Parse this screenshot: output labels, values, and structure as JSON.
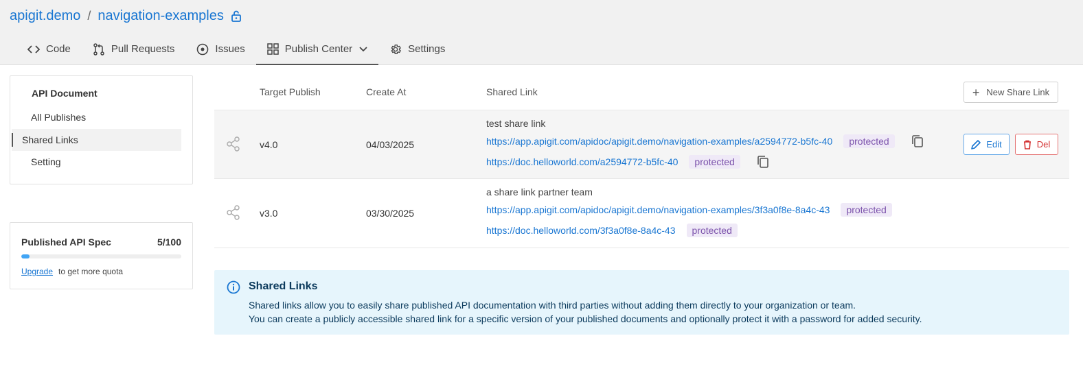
{
  "breadcrumb": {
    "org": "apigit.demo",
    "separator": "/",
    "repo": "navigation-examples"
  },
  "tabs": [
    {
      "label": "Code",
      "icon": "code-icon"
    },
    {
      "label": "Pull Requests",
      "icon": "pull-request-icon"
    },
    {
      "label": "Issues",
      "icon": "issues-icon"
    },
    {
      "label": "Publish Center",
      "icon": "grid-icon",
      "active": true
    },
    {
      "label": "Settings",
      "icon": "gear-icon"
    }
  ],
  "sidebar": {
    "title": "API Document",
    "items": [
      {
        "label": "All Publishes"
      },
      {
        "label": "Shared Links",
        "active": true
      },
      {
        "label": "Setting"
      }
    ]
  },
  "quota": {
    "title": "Published API Spec",
    "count": "5/100",
    "used_fraction": 0.05,
    "upgrade_label": "Upgrade",
    "suffix": "to get more quota"
  },
  "table": {
    "headers": {
      "target": "Target Publish",
      "created": "Create At",
      "link": "Shared Link"
    },
    "new_button": "New Share Link",
    "rows": [
      {
        "version": "v4.0",
        "created": "04/03/2025",
        "title": "test share link",
        "url1": "https://app.apigit.com/apidoc/apigit.demo/navigation-examples/a2594772-b5fc-40",
        "url2": "https://doc.helloworld.com/a2594772-b5fc-40",
        "badge": "protected"
      },
      {
        "version": "v3.0",
        "created": "03/30/2025",
        "title": "a share link partner team",
        "url1": "https://app.apigit.com/apidoc/apigit.demo/navigation-examples/3f3a0f8e-8a4c-43",
        "url2": "https://doc.helloworld.com/3f3a0f8e-8a4c-43",
        "badge": "protected"
      }
    ],
    "edit_label": "Edit",
    "del_label": "Del"
  },
  "info": {
    "title": "Shared Links",
    "line1": "Shared links allow you to easily share published API documentation with third parties without adding them directly to your organization or team.",
    "line2": "You can create a publicly accessible shared link for a specific version of your published documents and optionally protect it with a password for added security."
  },
  "colors": {
    "link": "#1976d2",
    "badge_bg": "#efe9f7",
    "badge_text": "#7b52ab",
    "info_bg": "#e6f5fc",
    "delete": "#d32f2f"
  }
}
